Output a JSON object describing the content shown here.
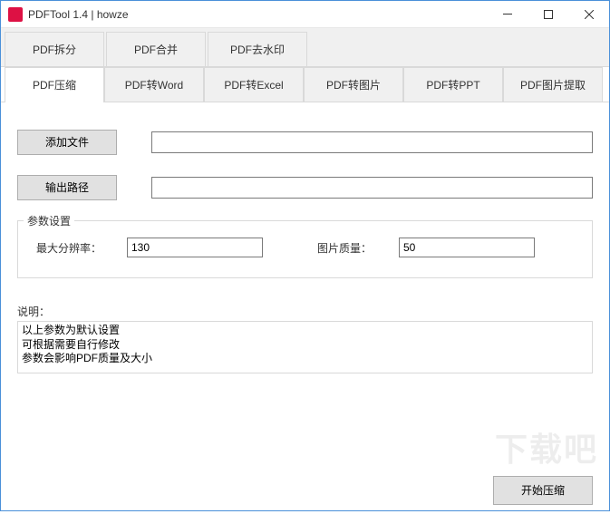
{
  "window": {
    "title": "PDFTool 1.4 |  howze"
  },
  "tabs_row1": [
    {
      "label": "PDF拆分"
    },
    {
      "label": "PDF合并"
    },
    {
      "label": "PDF去水印"
    }
  ],
  "tabs_row2": [
    {
      "label": "PDF压缩"
    },
    {
      "label": "PDF转Word"
    },
    {
      "label": "PDF转Excel"
    },
    {
      "label": "PDF转图片"
    },
    {
      "label": "PDF转PPT"
    },
    {
      "label": "PDF图片提取"
    }
  ],
  "buttons": {
    "add_file": "添加文件",
    "output_path": "输出路径",
    "start": "开始压缩"
  },
  "inputs": {
    "file_path": "",
    "output_path": ""
  },
  "params": {
    "legend": "参数设置",
    "max_res_label": "最大分辨率：",
    "max_res_value": "130",
    "img_quality_label": "图片质量：",
    "img_quality_value": "50"
  },
  "desc": {
    "label": "说明：",
    "text": "以上参数为默认设置\n可根据需要自行修改\n参数会影响PDF质量及大小"
  },
  "watermark": "下载吧"
}
